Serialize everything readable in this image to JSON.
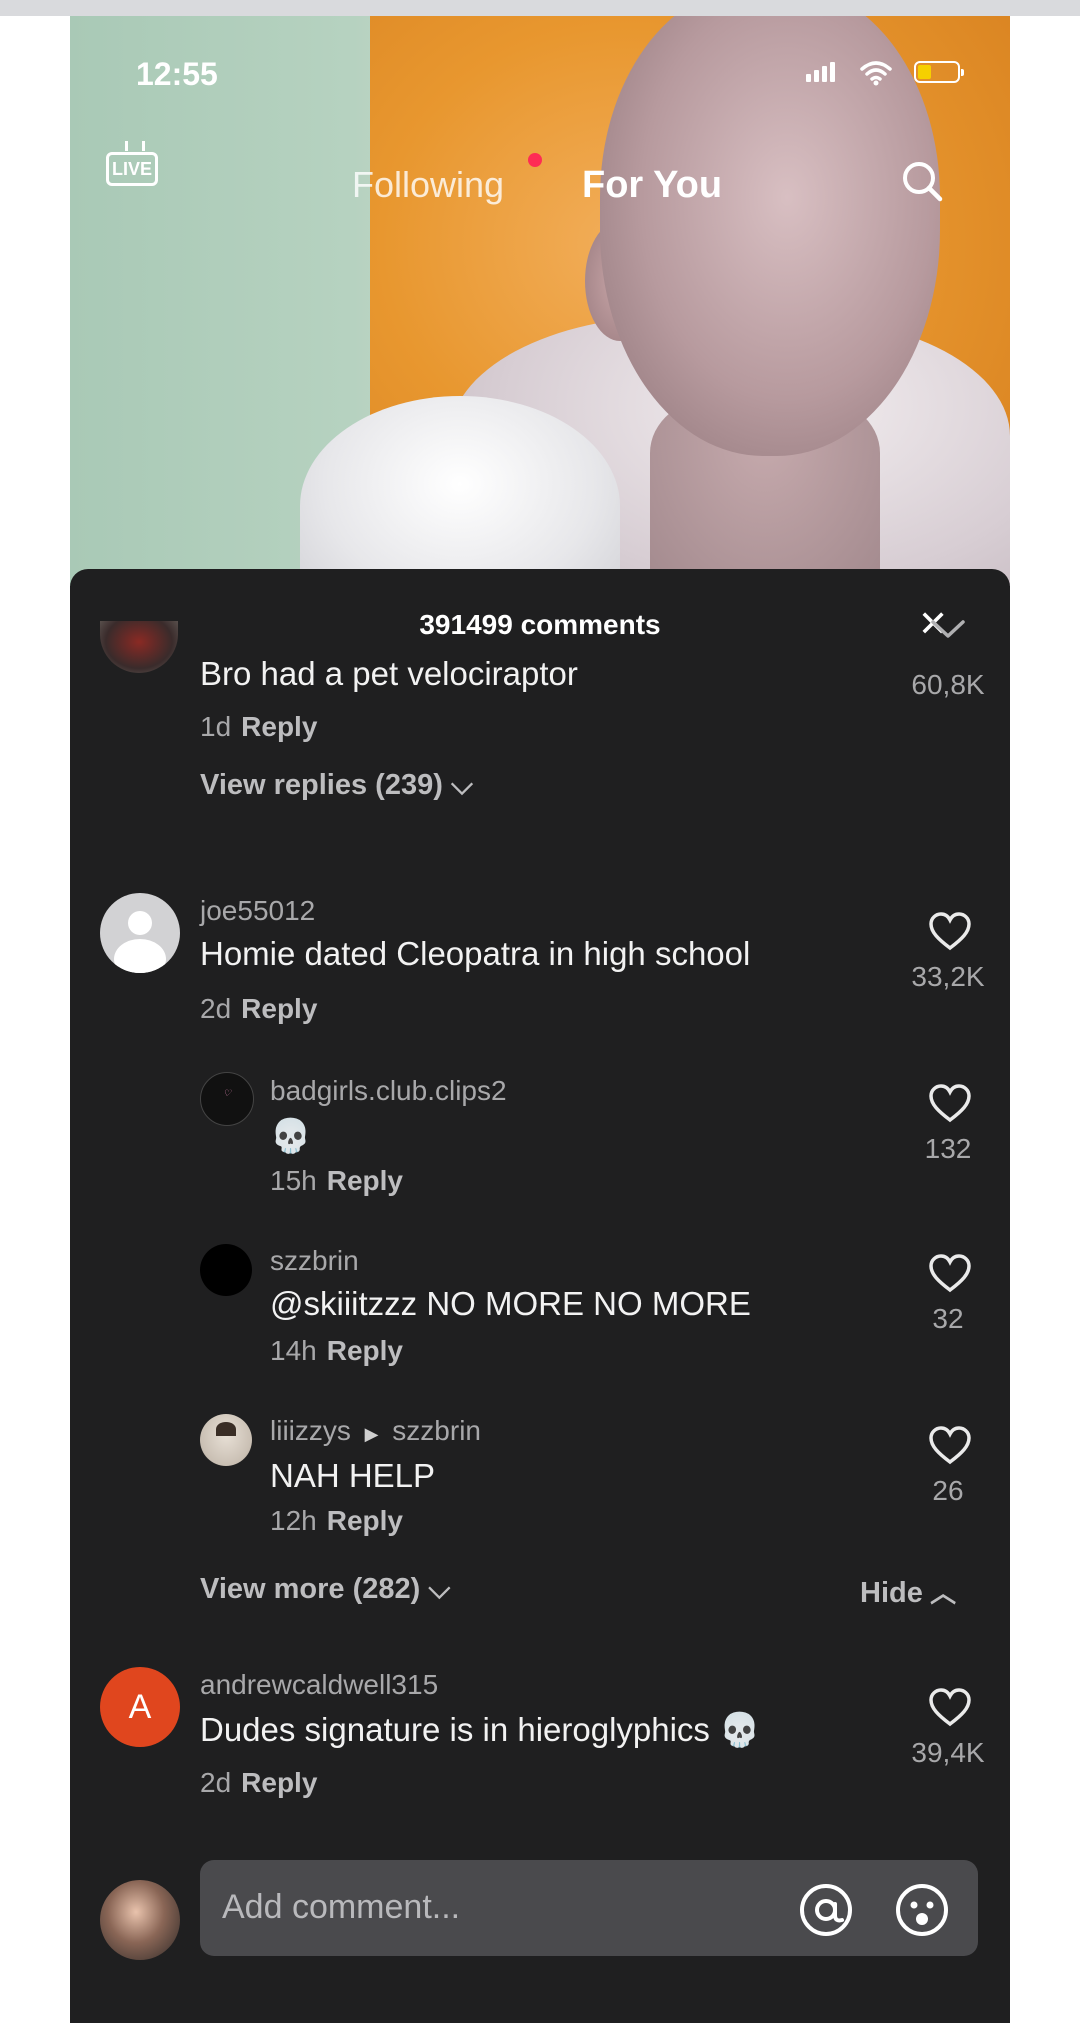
{
  "status_bar": {
    "time": "12:55",
    "icons": [
      "signal-icon",
      "wifi-icon",
      "battery-icon"
    ],
    "battery_color": "#f6d000"
  },
  "top_nav": {
    "live_label": "LIVE",
    "following": "Following",
    "for_you": "For You",
    "notification_dot_color": "#fe2c55"
  },
  "comments": {
    "header": "391499 comments",
    "items": [
      {
        "text": "Bro had a pet velociraptor",
        "age": "1d",
        "reply": "Reply",
        "likes": "60,8K",
        "view_replies": "View replies (239)"
      },
      {
        "username": "joe55012",
        "text": "Homie dated Cleopatra in high school",
        "age": "2d",
        "reply": "Reply",
        "likes": "33,2K",
        "replies": [
          {
            "username": "badgirls.club.clips2",
            "text": "💀",
            "age": "15h",
            "reply": "Reply",
            "likes": "132"
          },
          {
            "username": "szzbrin",
            "text": "@skiiitzzz NO MORE NO MORE",
            "age": "14h",
            "reply": "Reply",
            "likes": "32"
          },
          {
            "username": "liiizzys",
            "reply_to": "szzbrin",
            "text": "NAH HELP",
            "age": "12h",
            "reply": "Reply",
            "likes": "26"
          }
        ],
        "view_more": "View more (282)",
        "hide": "Hide"
      },
      {
        "username": "andrewcaldwell315",
        "avatar_letter": "A",
        "avatar_color": "#e0461e",
        "text": "Dudes signature is in hieroglyphics 💀",
        "age": "2d",
        "reply": "Reply",
        "likes": "39,4K"
      }
    ]
  },
  "composer": {
    "placeholder": "Add comment...",
    "icons": [
      "mention-icon",
      "emoji-icon"
    ]
  }
}
